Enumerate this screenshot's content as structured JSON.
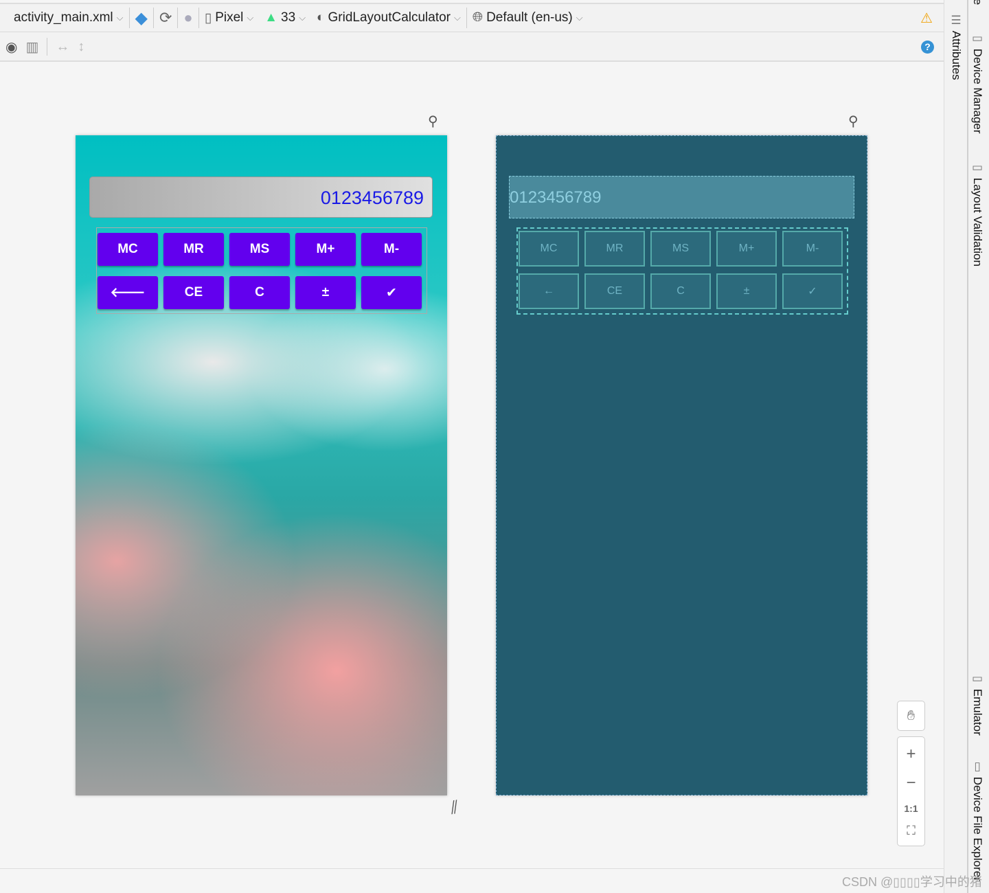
{
  "toolbar": {
    "file": "activity_main.xml",
    "device": "Pixel",
    "api": "33",
    "theme": "GridLayoutCalculator",
    "locale": "Default (en-us)"
  },
  "side_tabs": {
    "attributes": "Attributes",
    "device_manager": "Device Manager",
    "layout_validation": "Layout Validation",
    "emulator": "Emulator",
    "device_file_explorer": "Device File Explorer",
    "top_cut": "le"
  },
  "calculator": {
    "display": "0123456789",
    "row1": [
      "MC",
      "MR",
      "MS",
      "M+",
      "M-"
    ],
    "row2": [
      "🡐",
      "CE",
      "C",
      "±",
      "✔"
    ]
  },
  "blueprint": {
    "display": "0123456789",
    "row1": [
      "MC",
      "MR",
      "MS",
      "M+",
      "M-"
    ],
    "row2": [
      "←",
      "CE",
      "C",
      "±",
      "✓"
    ]
  },
  "zoom": {
    "one_to_one": "1:1"
  },
  "watermark": "CSDN @▯▯▯▯学习中的猪",
  "colors": {
    "button": "#6200ee",
    "blueprint": "#235c6f"
  }
}
